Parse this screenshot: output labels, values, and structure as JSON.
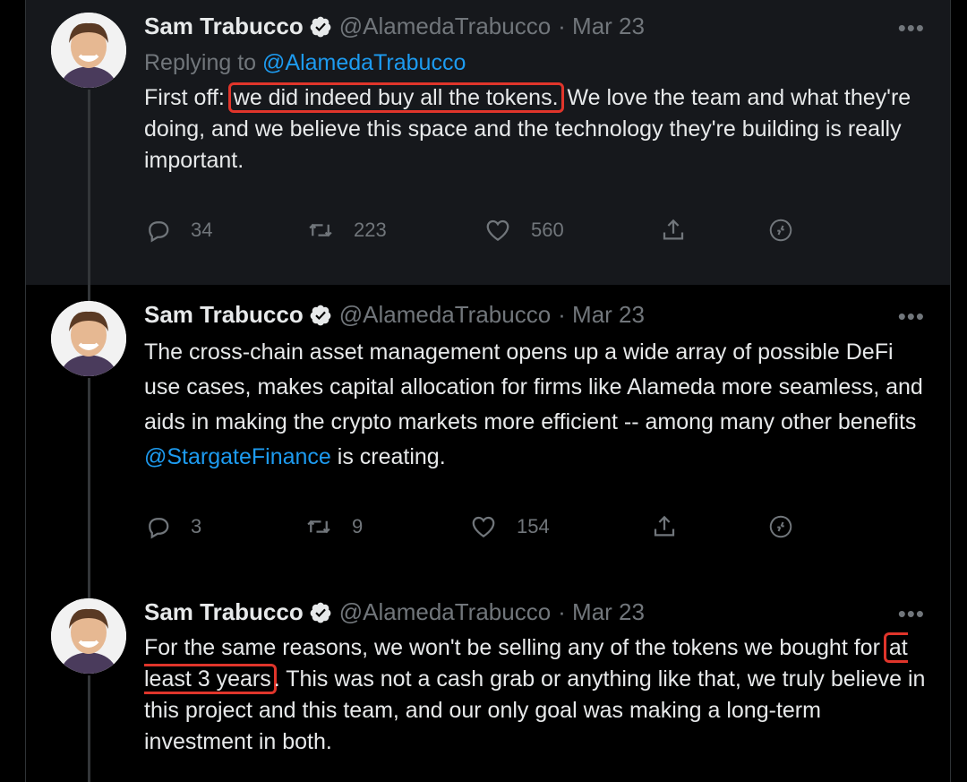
{
  "tweets": [
    {
      "name": "Sam Trabucco",
      "handle": "@AlamedaTrabucco",
      "date": "· Mar 23",
      "replying_prefix": "Replying to ",
      "replying_handle": "@AlamedaTrabucco",
      "text_before": "First off: ",
      "text_highlight": "we did indeed buy all the tokens.",
      "text_after": " We love the team and what they're doing, and we believe this space and the technology they're building is really important.",
      "replies": "34",
      "retweets": "223",
      "likes": "560"
    },
    {
      "name": "Sam Trabucco",
      "handle": "@AlamedaTrabucco",
      "date": "· Mar 23",
      "text_before": "The cross-chain asset management opens up a wide array of possible DeFi use cases, makes capital allocation for firms like Alameda more seamless, and aids in making the crypto markets more efficient -- among many other benefits ",
      "mention": "@StargateFinance",
      "text_after": " is creating.",
      "replies": "3",
      "retweets": "9",
      "likes": "154"
    },
    {
      "name": "Sam Trabucco",
      "handle": "@AlamedaTrabucco",
      "date": "· Mar 23",
      "text_before": "For the same reasons, we won't be selling any of the tokens we bought for ",
      "text_highlight": "at least 3 years",
      "text_after": ". This was not a cash grab or anything like that, we truly believe in this project and this team, and our only goal was making a long-term investment in both."
    }
  ],
  "more_glyph": "•••",
  "colors": {
    "highlight_box": "#e0352b",
    "link": "#1d9bf0",
    "verified": "#e7e9ea"
  }
}
